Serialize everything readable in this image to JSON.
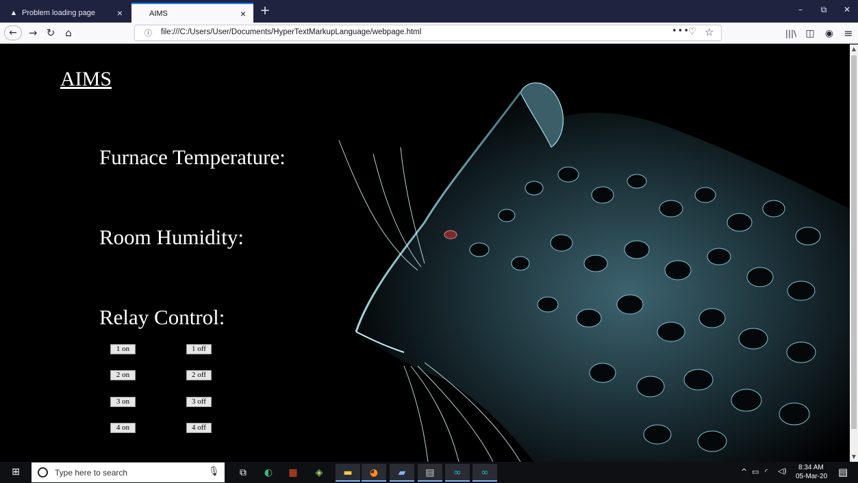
{
  "browser": {
    "tabs": [
      {
        "title": "Problem loading page",
        "icon": "warning-icon",
        "active": false
      },
      {
        "title": "AIMS",
        "icon": "",
        "active": true
      }
    ],
    "new_tab": "+",
    "window_controls": {
      "minimize": "–",
      "maximize": "⧉",
      "close": "✕"
    },
    "nav": {
      "back": "←",
      "forward": "→",
      "reload": "↻",
      "home": "⌂"
    },
    "url": "file:///C:/Users/User/Documents/HyperTextMarkupLanguage/webpage.html",
    "url_icons": {
      "info": "ⓘ",
      "more": "•••",
      "pocket": "♡",
      "star": "☆"
    },
    "toolbar": {
      "library": "|||\\",
      "sidebar": "◫",
      "account": "◉",
      "menu": "≡"
    }
  },
  "page": {
    "title": "AIMS",
    "sections": {
      "temperature": "Furnace Temperature:",
      "humidity": "Room Humidity:",
      "relay": "Relay Control:"
    },
    "relays": [
      {
        "on": "1 on",
        "off": "1 off"
      },
      {
        "on": "2 on",
        "off": "2 off"
      },
      {
        "on": "3 on",
        "off": "3 off"
      },
      {
        "on": "4 on",
        "off": "4 off"
      }
    ],
    "scroll": {
      "up": "▲",
      "down": "▼"
    }
  },
  "taskbar": {
    "start_icon": "windows-start-icon",
    "search_placeholder": "Type here to search",
    "icons": {
      "mic": "🎙",
      "taskview": "⧉",
      "edge": "◐",
      "store": "▦",
      "paint": "◈",
      "explorer": "▬",
      "firefox": "◕",
      "notepad": "▰",
      "calc": "▤",
      "arduino1": "∞",
      "arduino2": "∞"
    },
    "tray": {
      "chevron": "^",
      "battery": "▭",
      "wifi": "◜",
      "volume": "◁)"
    },
    "time": "8:34 AM",
    "date": "05-Mar-20",
    "notification": "▤"
  },
  "colors": {
    "page_background": "#000000",
    "text": "#ffffff",
    "tab_bar": "#202340",
    "active_tab_accent": "#0a84ff",
    "leopard_glow": "#8fd8e8"
  }
}
